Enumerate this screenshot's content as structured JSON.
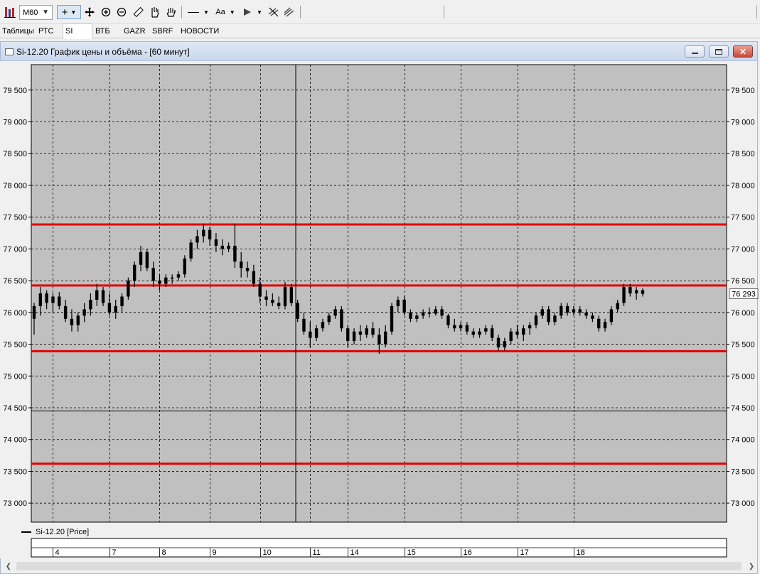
{
  "toolbar": {
    "timeframe": "M60",
    "icons": [
      "chart-type-icon",
      "crosshair-icon",
      "move-icon",
      "zoom-in-icon",
      "zoom-out-icon",
      "ruler-icon",
      "hand-select-icon",
      "pan-hand-icon",
      "line-tool-icon",
      "text-tool-icon",
      "marker-tool-icon",
      "hide-drawings-icon",
      "delete-drawings-icon"
    ],
    "text_tool_label": "Aa"
  },
  "tabs": [
    {
      "label": "Таблицы",
      "active": false
    },
    {
      "label": "РТС",
      "active": false
    },
    {
      "label": "SI",
      "active": true
    },
    {
      "label": "ВТБ",
      "active": false
    },
    {
      "label": "GAZR",
      "active": false
    },
    {
      "label": "SBRF",
      "active": false
    },
    {
      "label": "НОВОСТИ",
      "active": false
    }
  ],
  "window": {
    "title": "Si-12.20 График цены и объёма - [60 минут]"
  },
  "legend": {
    "series_label": "Si-12.20 [Price]"
  },
  "chart_data": {
    "type": "candlestick",
    "instrument": "Si-12.20",
    "timeframe": "60 минут",
    "y_ticks": [
      "79 500",
      "79 000",
      "78 500",
      "78 000",
      "77 500",
      "77 000",
      "76 500",
      "76 000",
      "75 500",
      "75 000",
      "74 500",
      "74 000",
      "73 500",
      "73 000"
    ],
    "y_tick_values": [
      79500,
      79000,
      78500,
      78000,
      77500,
      77000,
      76500,
      76000,
      75500,
      75000,
      74500,
      74000,
      73500,
      73000
    ],
    "ylim": [
      72700,
      79900
    ],
    "x_day_labels": [
      "4",
      "7",
      "8",
      "9",
      "10",
      "11",
      "14",
      "15",
      "16",
      "17",
      "18"
    ],
    "last_price_label": "76 293",
    "last_price": 76293,
    "horizontal_levels": [
      77385,
      76425,
      75390,
      73620
    ],
    "level_color": "#e00000",
    "background_color": "#c0c0c0",
    "candles": [
      [
        75900,
        76150,
        75650,
        76100
      ],
      [
        76100,
        76400,
        75950,
        76300
      ],
      [
        76300,
        76350,
        76050,
        76150
      ],
      [
        76150,
        76300,
        76000,
        76250
      ],
      [
        76250,
        76320,
        76050,
        76100
      ],
      [
        76100,
        76200,
        75850,
        75900
      ],
      [
        75900,
        76050,
        75700,
        75800
      ],
      [
        75800,
        76000,
        75700,
        75950
      ],
      [
        75950,
        76150,
        75850,
        76050
      ],
      [
        76050,
        76300,
        75950,
        76200
      ],
      [
        76200,
        76450,
        76100,
        76350
      ],
      [
        76350,
        76400,
        76100,
        76150
      ],
      [
        76150,
        76300,
        75950,
        76000
      ],
      [
        76000,
        76200,
        75900,
        76100
      ],
      [
        76100,
        76300,
        76000,
        76250
      ],
      [
        76250,
        76550,
        76200,
        76500
      ],
      [
        76500,
        76800,
        76400,
        76750
      ],
      [
        76750,
        77050,
        76650,
        76950
      ],
      [
        76950,
        77000,
        76650,
        76700
      ],
      [
        76700,
        76800,
        76400,
        76500
      ],
      [
        76500,
        76600,
        76350,
        76450
      ],
      [
        76450,
        76600,
        76400,
        76550
      ],
      [
        76550,
        76600,
        76450,
        76550
      ],
      [
        76550,
        76650,
        76500,
        76600
      ],
      [
        76600,
        76900,
        76550,
        76850
      ],
      [
        76850,
        77150,
        76800,
        77100
      ],
      [
        77100,
        77300,
        77000,
        77200
      ],
      [
        77200,
        77400,
        77100,
        77300
      ],
      [
        77300,
        77350,
        77050,
        77150
      ],
      [
        77150,
        77250,
        76950,
        77050
      ],
      [
        77050,
        77150,
        76900,
        77000
      ],
      [
        77000,
        77100,
        76950,
        77050
      ],
      [
        77050,
        77400,
        76700,
        76800
      ],
      [
        76800,
        76950,
        76550,
        76700
      ],
      [
        76700,
        76800,
        76550,
        76650
      ],
      [
        76650,
        76750,
        76400,
        76450
      ],
      [
        76450,
        76550,
        76150,
        76250
      ],
      [
        76250,
        76350,
        76100,
        76200
      ],
      [
        76200,
        76300,
        76100,
        76150
      ],
      [
        76150,
        76250,
        76050,
        76100
      ],
      [
        76100,
        76480,
        76050,
        76400
      ],
      [
        76400,
        76450,
        76100,
        76150
      ],
      [
        76150,
        76200,
        75850,
        75900
      ],
      [
        75900,
        76000,
        75650,
        75700
      ],
      [
        75700,
        75850,
        75450,
        75600
      ],
      [
        75600,
        75800,
        75550,
        75750
      ],
      [
        75750,
        75900,
        75700,
        75850
      ],
      [
        75850,
        76000,
        75800,
        75950
      ],
      [
        75950,
        76100,
        75900,
        76050
      ],
      [
        76050,
        76100,
        75700,
        75750
      ],
      [
        75750,
        75800,
        75450,
        75550
      ],
      [
        75550,
        75750,
        75500,
        75700
      ],
      [
        75700,
        75800,
        75550,
        75650
      ],
      [
        75650,
        75800,
        75600,
        75750
      ],
      [
        75750,
        75850,
        75600,
        75650
      ],
      [
        75650,
        75750,
        75350,
        75500
      ],
      [
        75500,
        75800,
        75450,
        75700
      ],
      [
        75700,
        76150,
        75650,
        76100
      ],
      [
        76100,
        76250,
        76000,
        76200
      ],
      [
        76200,
        76250,
        75950,
        76000
      ],
      [
        76000,
        76050,
        75850,
        75900
      ],
      [
        75900,
        76000,
        75850,
        75950
      ],
      [
        75950,
        76050,
        75900,
        76000
      ],
      [
        76000,
        76080,
        75920,
        75980
      ],
      [
        75980,
        76100,
        75950,
        76050
      ],
      [
        76050,
        76100,
        75900,
        75950
      ],
      [
        75950,
        75980,
        75750,
        75800
      ],
      [
        75800,
        75900,
        75700,
        75750
      ],
      [
        75750,
        75850,
        75700,
        75800
      ],
      [
        75800,
        75850,
        75650,
        75700
      ],
      [
        75700,
        75750,
        75600,
        75650
      ],
      [
        75650,
        75750,
        75600,
        75700
      ],
      [
        75700,
        75800,
        75650,
        75750
      ],
      [
        75750,
        75800,
        75550,
        75600
      ],
      [
        75600,
        75650,
        75400,
        75450
      ],
      [
        75450,
        75600,
        75400,
        75550
      ],
      [
        75550,
        75750,
        75500,
        75700
      ],
      [
        75700,
        75800,
        75600,
        75650
      ],
      [
        75650,
        75800,
        75550,
        75750
      ],
      [
        75750,
        75850,
        75650,
        75800
      ],
      [
        75800,
        76000,
        75750,
        75950
      ],
      [
        75950,
        76100,
        75900,
        76050
      ],
      [
        76050,
        76100,
        75800,
        75850
      ],
      [
        75850,
        76000,
        75800,
        75950
      ],
      [
        75950,
        76150,
        75900,
        76100
      ],
      [
        76100,
        76150,
        75950,
        76000
      ],
      [
        76000,
        76100,
        75950,
        76050
      ],
      [
        76050,
        76100,
        75950,
        76000
      ],
      [
        76000,
        76050,
        75900,
        75950
      ],
      [
        75950,
        76000,
        75850,
        75900
      ],
      [
        75900,
        75950,
        75700,
        75750
      ],
      [
        75750,
        75900,
        75700,
        75850
      ],
      [
        75850,
        76100,
        75800,
        76050
      ],
      [
        76050,
        76200,
        76000,
        76150
      ],
      [
        76150,
        76450,
        76100,
        76400
      ],
      [
        76400,
        76450,
        76250,
        76300
      ],
      [
        76300,
        76400,
        76200,
        76350
      ],
      [
        76350,
        76380,
        76250,
        76293
      ]
    ]
  }
}
